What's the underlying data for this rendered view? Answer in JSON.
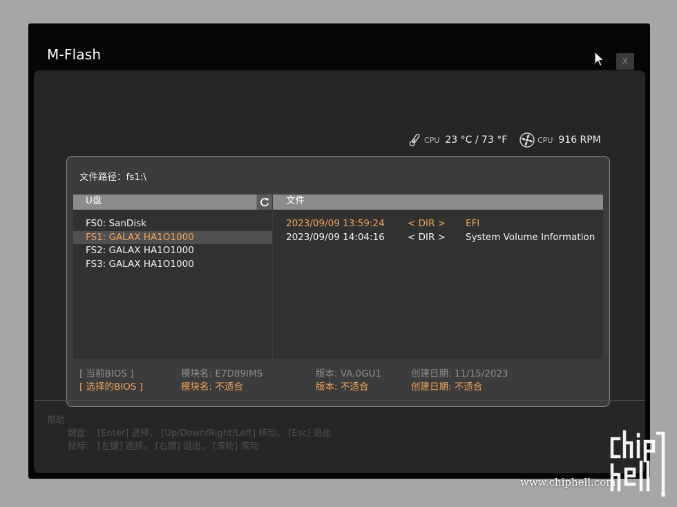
{
  "window": {
    "title": "M-Flash",
    "close_label": "X"
  },
  "hardware": {
    "cpu_temp": {
      "label": "CPU",
      "value": "23 °C / 73 °F"
    },
    "cpu_fan": {
      "label": "CPU",
      "value": "916 RPM"
    }
  },
  "dialog": {
    "path_label": "文件路径：fs1:\\",
    "usb_pane": {
      "header": "U盘",
      "drives": [
        {
          "label": "FS0: SanDisk",
          "selected": false
        },
        {
          "label": "FS1: GALAX HA1O1000",
          "selected": true
        },
        {
          "label": "FS2: GALAX HA1O1000",
          "selected": false
        },
        {
          "label": "FS3: GALAX HA1O1000",
          "selected": false
        }
      ]
    },
    "files_pane": {
      "header": "文件",
      "files": [
        {
          "date": "2023/09/09 13:59:24",
          "type": "< DIR >",
          "name": "EFI",
          "selected": true
        },
        {
          "date": "2023/09/09 14:04:16",
          "type": "< DIR >",
          "name": "System Volume Information",
          "selected": false
        }
      ]
    },
    "bios": {
      "current": {
        "label": "[     当前BIOS     ]",
        "module": "模块名: E7D89IMS",
        "version": "版本: VA.0GU1",
        "date": "创建日期: 11/15/2023"
      },
      "selected": {
        "label": "[   选择的BIOS   ]",
        "module": "模块名: 不适合",
        "version": "版本: 不适合",
        "date": "创建日期: 不适合"
      }
    }
  },
  "help": {
    "title": "帮助",
    "keyboard": "键盘：  [Enter] 选择，  [Up/Down/Right/Left] 移动，  [Esc] 退出",
    "mouse": "鼠标：  [左键] 选择，  [右键] 退出，  [滚轮] 滚动"
  },
  "watermark": {
    "url": "www.chiphell.com",
    "logo_text": "chip hell"
  },
  "colors": {
    "accent": "#f0a45b",
    "background": "#a6a6a6",
    "panel": "#262626"
  }
}
